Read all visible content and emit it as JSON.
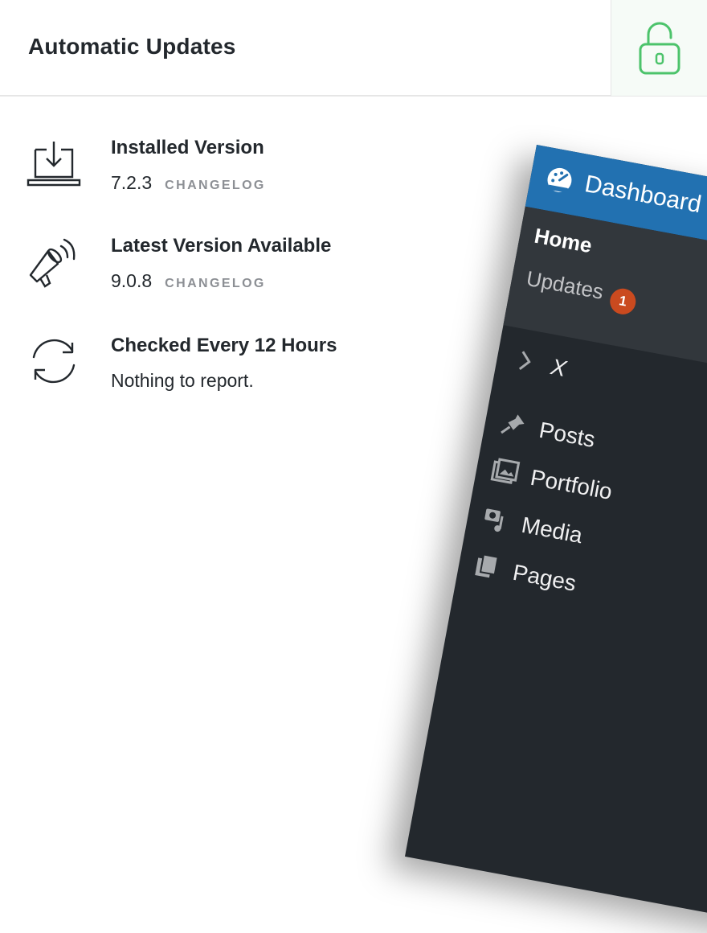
{
  "header": {
    "title": "Automatic Updates",
    "lock_icon": "unlocked-padlock-icon"
  },
  "rows": [
    {
      "icon": "laptop-download-icon",
      "title": "Installed Version",
      "value": "7.2.3",
      "link": "CHANGELOG"
    },
    {
      "icon": "megaphone-icon",
      "title": "Latest Version Available",
      "value": "9.0.8",
      "link": "CHANGELOG"
    },
    {
      "icon": "refresh-icon",
      "title": "Checked Every 12 Hours",
      "value": "Nothing to report."
    }
  ],
  "wp_menu": {
    "dashboard": "Dashboard",
    "home": "Home",
    "updates": "Updates",
    "updates_count": "1",
    "items": [
      {
        "icon": "chevron-right-icon",
        "label": "X"
      },
      {
        "icon": "pin-icon",
        "label": "Posts"
      },
      {
        "icon": "portfolio-icon",
        "label": "Portfolio"
      },
      {
        "icon": "media-icon",
        "label": "Media"
      },
      {
        "icon": "pages-icon",
        "label": "Pages"
      }
    ]
  },
  "colors": {
    "accent_green": "#4cc36b",
    "wp_blue": "#2271b1",
    "wp_dark": "#23282d",
    "badge": "#ca4a1f"
  }
}
